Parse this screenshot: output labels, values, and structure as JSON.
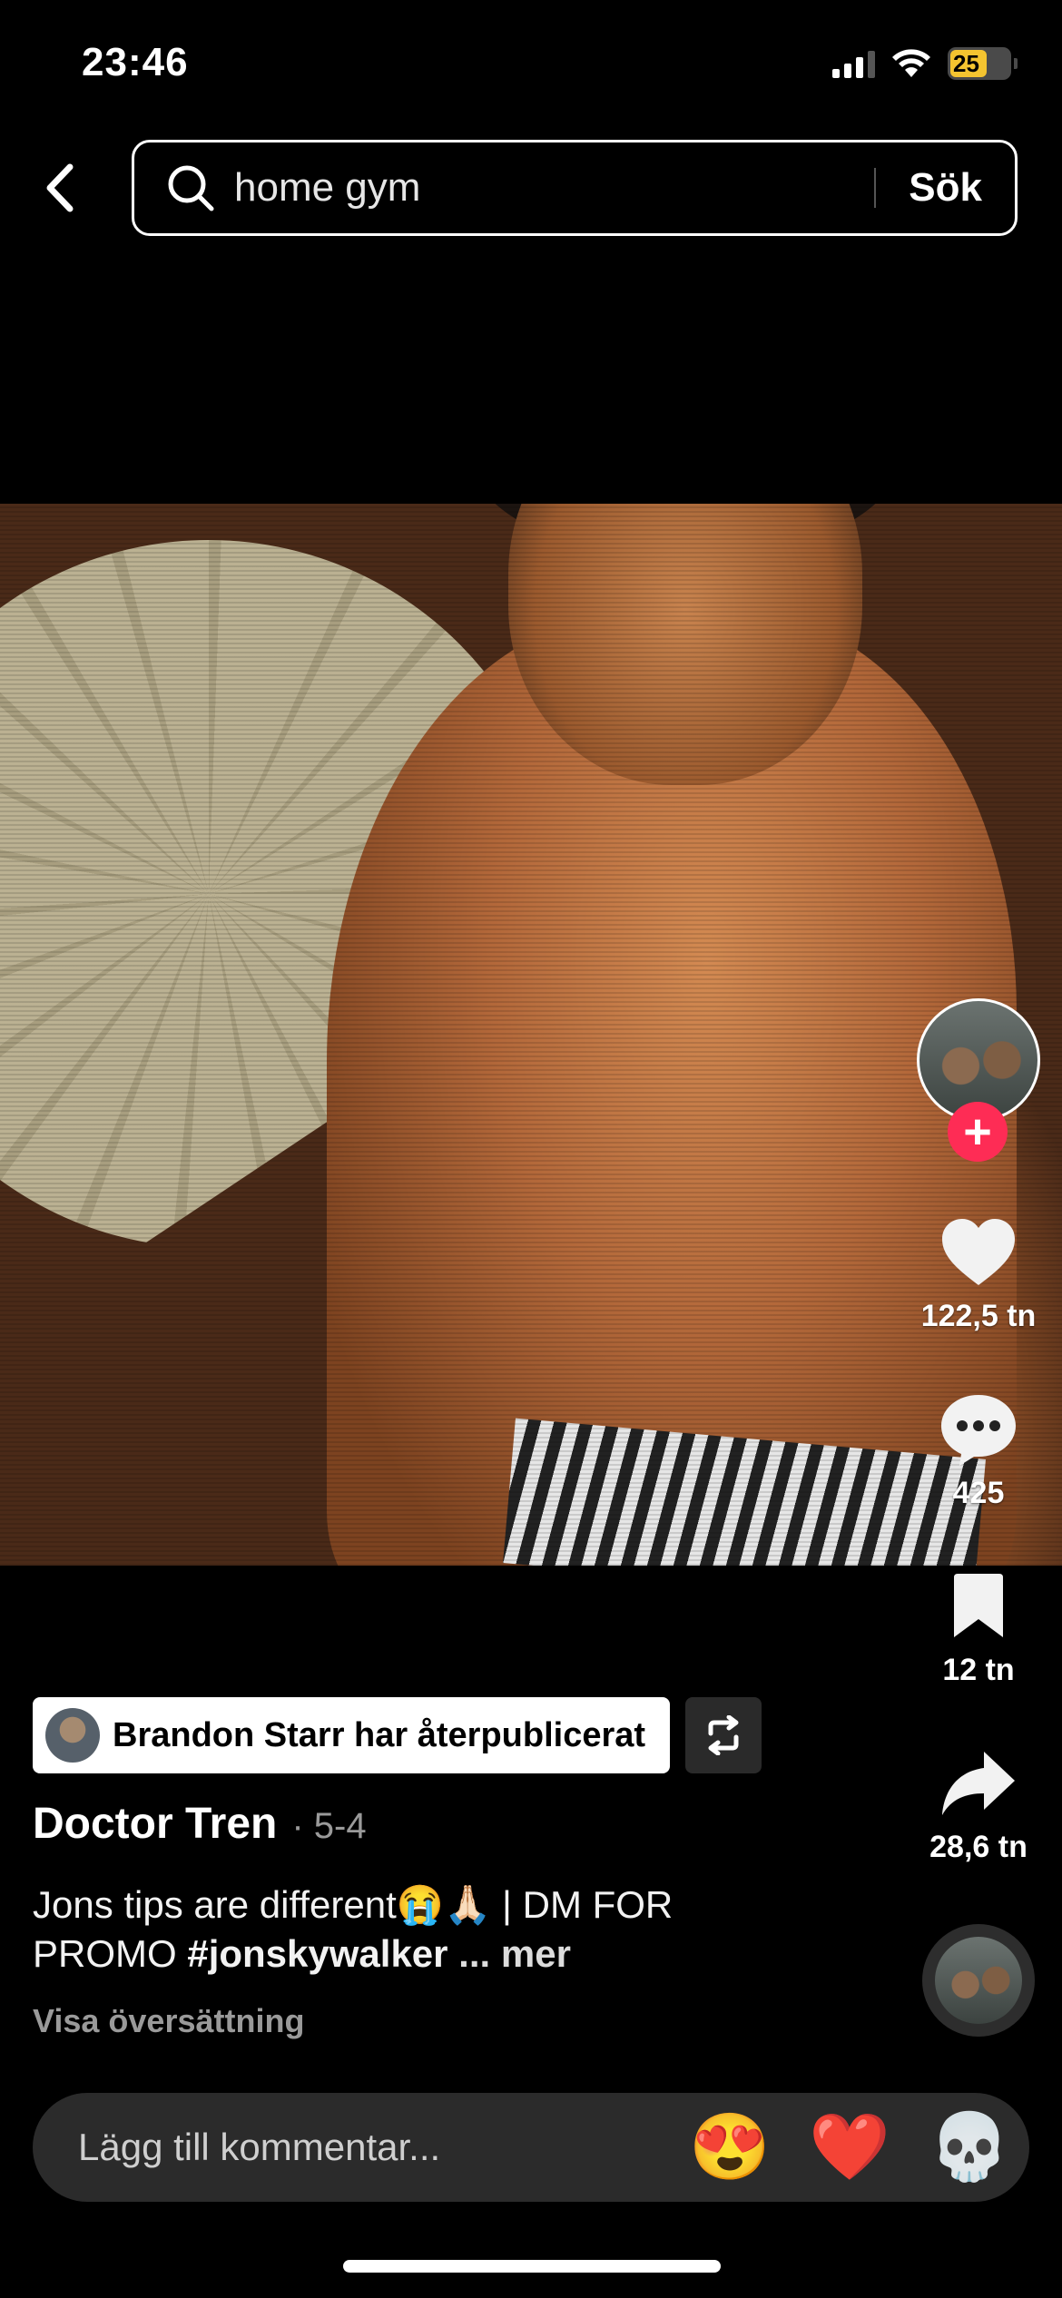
{
  "status_bar": {
    "time": "23:46",
    "battery": "25"
  },
  "search": {
    "query": "home gym",
    "submit_label": "Sök"
  },
  "actions": {
    "likes": "122,5 tn",
    "comments": "425",
    "saves": "12 tn",
    "shares": "28,6 tn"
  },
  "repost": {
    "text": "Brandon Starr har återpublicerat"
  },
  "post": {
    "author": "Doctor Tren",
    "date": "· 5-4",
    "caption_start": "Jons tips are different😭🙏🏻 | DM FOR PROMO ",
    "hashtag": "#jonskywalker",
    "more": " ... mer",
    "translate": "Visa översättning"
  },
  "comment_bar": {
    "placeholder": "Lägg till kommentar...",
    "emojis": [
      "😍",
      "❤️",
      "💀"
    ]
  },
  "colors": {
    "accent": "#fe2c55",
    "background": "#000000",
    "battery": "#f4c430"
  }
}
